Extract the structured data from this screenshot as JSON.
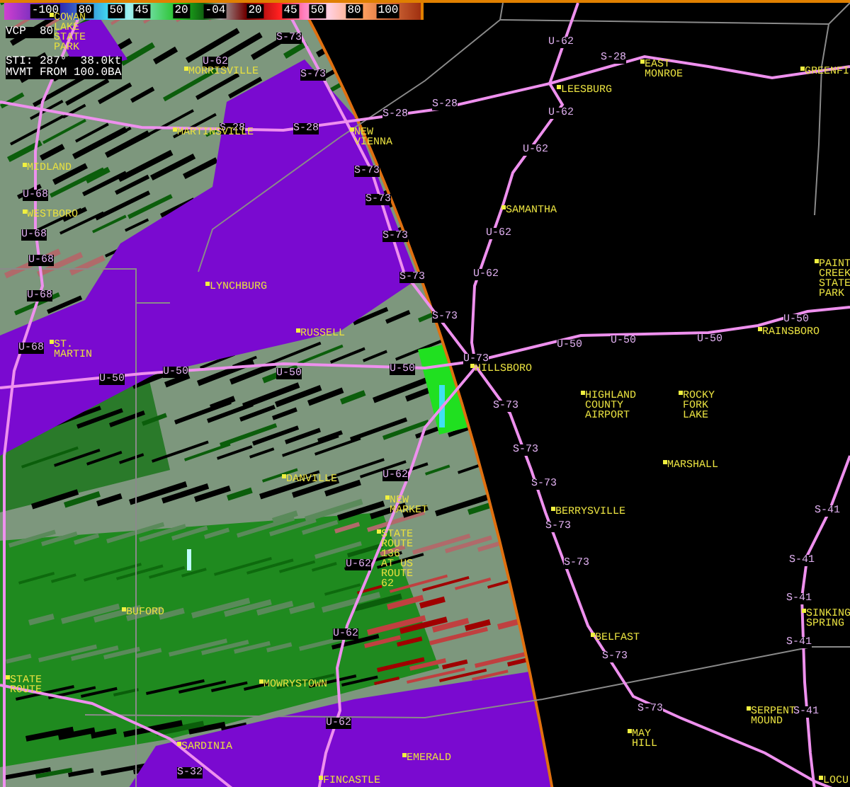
{
  "legend": {
    "labels": [
      "-100",
      "80",
      "50",
      "45",
      "20",
      "-04",
      "20",
      "45",
      "50",
      "80",
      "100"
    ]
  },
  "info": [
    "VCP  80",
    "STI: 287°  38.0kt",
    "MVMT FROM 100.0BA"
  ],
  "places": [
    {
      "name": "COWAN LAKE STATE PARK",
      "kind": "stacked"
    },
    {
      "name": "MORRISVILLE",
      "kind": "single"
    },
    {
      "name": "MARTINSVILLE",
      "kind": "single"
    },
    {
      "name": "NEW VIENNA",
      "kind": "stacked"
    },
    {
      "name": "MIDLAND",
      "kind": "single"
    },
    {
      "name": "LEESBURG",
      "kind": "single"
    },
    {
      "name": "EAST MONROE",
      "kind": "stacked"
    },
    {
      "name": "GREENFI",
      "kind": "single"
    },
    {
      "name": "WESTBORO",
      "kind": "single"
    },
    {
      "name": "SAMANTHA",
      "kind": "single"
    },
    {
      "name": "PAINT CREEK STATE PARK",
      "kind": "stacked"
    },
    {
      "name": "LYNCHBURG",
      "kind": "single"
    },
    {
      "name": "RUSSELL",
      "kind": "single"
    },
    {
      "name": "ST. MARTIN",
      "kind": "stacked"
    },
    {
      "name": "RAINSBORO",
      "kind": "single"
    },
    {
      "name": "HILLSBORO",
      "kind": "single"
    },
    {
      "name": "HIGHLAND COUNTY AIRPORT",
      "kind": "stacked"
    },
    {
      "name": "ROCKY FORK LAKE",
      "kind": "stacked"
    },
    {
      "name": "MARSHALL",
      "kind": "single"
    },
    {
      "name": "DANVILLE",
      "kind": "single"
    },
    {
      "name": "NEW MARKET",
      "kind": "stacked"
    },
    {
      "name": "BERRYSVILLE",
      "kind": "single"
    },
    {
      "name": "STATE ROUTE 136 AT US ROUTE 62",
      "kind": "stacked"
    },
    {
      "name": "BUFORD",
      "kind": "single"
    },
    {
      "name": "SINKING SPRING",
      "kind": "stacked"
    },
    {
      "name": "BELFAST",
      "kind": "single"
    },
    {
      "name": "STATE ROUTE",
      "kind": "stacked"
    },
    {
      "name": "MOWRYSTOWN",
      "kind": "single"
    },
    {
      "name": "SERPENT MOUND",
      "kind": "stacked"
    },
    {
      "name": "MAY HILL",
      "kind": "stacked"
    },
    {
      "name": "SARDINIA",
      "kind": "single"
    },
    {
      "name": "EMERALD",
      "kind": "single"
    },
    {
      "name": "FINCASTLE",
      "kind": "single"
    },
    {
      "name": "LOCU",
      "kind": "single"
    }
  ],
  "road_labels": [
    "S-73",
    "S-73",
    "U-62",
    "S-28",
    "S-28",
    "U-62",
    "S-28",
    "S-28",
    "U-62",
    "S-28",
    "S-73",
    "S-73",
    "U-68",
    "U-68",
    "U-68",
    "U-62",
    "S-73",
    "U-62",
    "U-68",
    "U-68",
    "U-50",
    "U-50",
    "U-50",
    "U-50",
    "U-73",
    "U-50",
    "U-50",
    "U-50",
    "U-50",
    "S-73",
    "S-73",
    "S-73",
    "U-62",
    "U-62",
    "S-73",
    "S-73",
    "S-41",
    "S-73",
    "S-41",
    "S-41",
    "S-73",
    "S-41",
    "U-62",
    "U-62",
    "S-73",
    "S-41",
    "S-73",
    "U-62",
    "S-32"
  ]
}
